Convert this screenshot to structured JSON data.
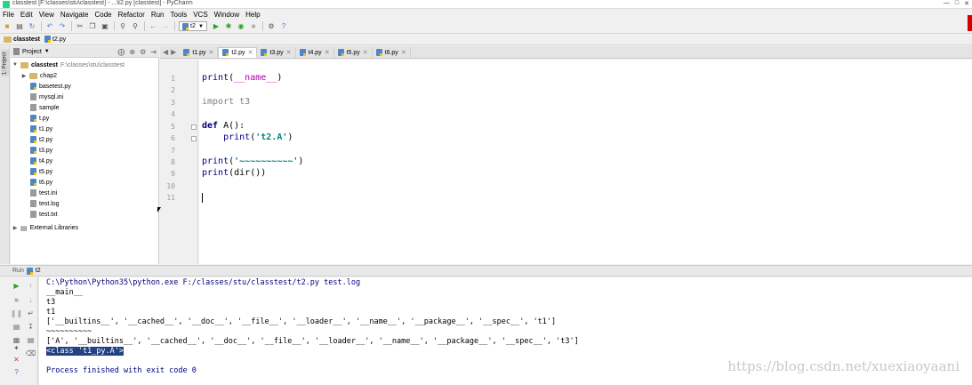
{
  "window": {
    "title": "classtest [F:\\classes\\stu\\classtest] - ...\\t2.py [classtest] - PyCharm"
  },
  "menu": [
    "File",
    "Edit",
    "View",
    "Navigate",
    "Code",
    "Refactor",
    "Run",
    "Tools",
    "VCS",
    "Window",
    "Help"
  ],
  "toolbar": {
    "run_config": "t2"
  },
  "breadcrumb": {
    "project": "classtest",
    "file": "t2.py"
  },
  "sidebar": {
    "tab_label": "1: Project",
    "header": "Project",
    "root": {
      "name": "classtest",
      "path": "F:\\classes\\stu\\classtest"
    },
    "items": [
      {
        "name": "chap2",
        "kind": "folder"
      },
      {
        "name": "basetest.py",
        "kind": "py"
      },
      {
        "name": "mysql.ini",
        "kind": "file"
      },
      {
        "name": "sample",
        "kind": "file"
      },
      {
        "name": "t.py",
        "kind": "py"
      },
      {
        "name": "t1.py",
        "kind": "py"
      },
      {
        "name": "t2.py",
        "kind": "py"
      },
      {
        "name": "t3.py",
        "kind": "py"
      },
      {
        "name": "t4.py",
        "kind": "py"
      },
      {
        "name": "t5.py",
        "kind": "py"
      },
      {
        "name": "t6.py",
        "kind": "py"
      },
      {
        "name": "test.ini",
        "kind": "file"
      },
      {
        "name": "test.log",
        "kind": "file"
      },
      {
        "name": "test.txt",
        "kind": "file"
      }
    ],
    "external": "External Libraries"
  },
  "tabs": [
    "t1.py",
    "t2.py",
    "t3.py",
    "t4.py",
    "t5.py",
    "t6.py"
  ],
  "active_tab": "t2.py",
  "editor": {
    "line_numbers": [
      "1",
      "2",
      "3",
      "4",
      "5",
      "6",
      "7",
      "8",
      "9",
      "10",
      "11"
    ],
    "lines": {
      "l1_fn": "print",
      "l1_open": "(",
      "l1_magic": "__name__",
      "l1_close": ")",
      "l3_kw": "import",
      "l3_mod": " t3",
      "l5_kw": "def",
      "l5_rest": " A():",
      "l6_indent": "    ",
      "l6_fn": "print",
      "l6_open": "(",
      "l6_str": "'t2.A'",
      "l6_close": ")",
      "l8_fn": "print",
      "l8_open": "(",
      "l8_str": "'~~~~~~~~~~'",
      "l8_close": ")",
      "l9_fn": "print",
      "l9_rest": "(dir())"
    }
  },
  "run": {
    "label": "Run",
    "config": "t2",
    "output": [
      "C:\\Python\\Python35\\python.exe F:/classes/stu/classtest/t2.py test.log",
      "__main__",
      "t3",
      "t1",
      "['__builtins__', '__cached__', '__doc__', '__file__', '__loader__', '__name__', '__package__', '__spec__', 't1']",
      "~~~~~~~~~~",
      "['A', '__builtins__', '__cached__', '__doc__', '__file__', '__loader__', '__name__', '__package__', '__spec__', 't3']",
      "<class 't1_py.A'>",
      "",
      "Process finished with exit code 0"
    ]
  },
  "watermark": "https://blog.csdn.net/xuexiaoyaani",
  "colors": {
    "keyword": "#000080",
    "string": "#008080",
    "selection": "#214283",
    "caret_line": "#fffae3"
  }
}
